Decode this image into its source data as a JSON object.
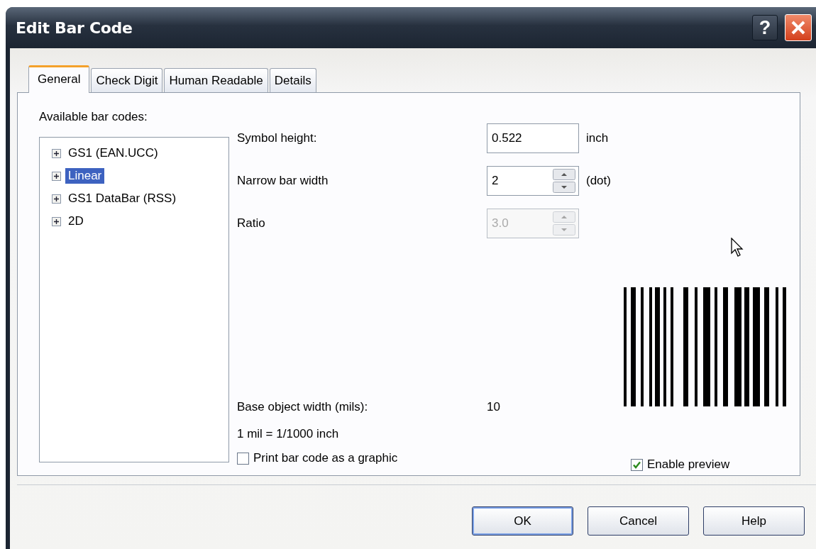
{
  "window": {
    "title": "Edit Bar Code"
  },
  "help_button": {
    "label": "?"
  },
  "tabs": [
    {
      "label": "General",
      "selected": true
    },
    {
      "label": "Check Digit",
      "selected": false
    },
    {
      "label": "Human Readable",
      "selected": false
    },
    {
      "label": "Details",
      "selected": false
    }
  ],
  "tree": {
    "label": "Available bar codes:",
    "items": [
      {
        "label": "GS1 (EAN.UCC)",
        "selected": false,
        "expanded": false
      },
      {
        "label": "Linear",
        "selected": true,
        "expanded": false
      },
      {
        "label": "GS1 DataBar (RSS)",
        "selected": false,
        "expanded": false
      },
      {
        "label": "2D",
        "selected": false,
        "expanded": false
      }
    ]
  },
  "fields": [
    {
      "kind": "text",
      "label": "Symbol height:",
      "value": "0.522",
      "unit": "inch",
      "disabled": false
    },
    {
      "kind": "spin",
      "label": "Narrow bar width",
      "value": "2",
      "unit": "(dot)",
      "disabled": false
    },
    {
      "kind": "spin",
      "label": "Ratio",
      "value": "3.0",
      "disabled": true
    }
  ],
  "base_width": {
    "label": "Base object width (mils):",
    "value": "10"
  },
  "note": "1 mil = 1/1000 inch",
  "print_graphic": {
    "label": "Print bar code as a graphic",
    "checked": false
  },
  "enable_preview": {
    "label": "Enable preview",
    "checked": true
  },
  "buttons": [
    {
      "label": "OK",
      "default": true
    },
    {
      "label": "Cancel",
      "default": false
    },
    {
      "label": "Help",
      "default": false
    }
  ]
}
